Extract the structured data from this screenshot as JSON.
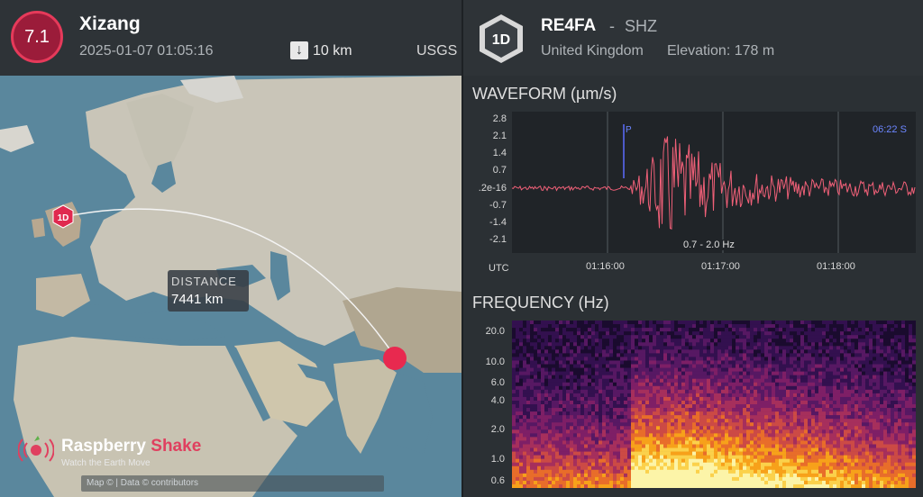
{
  "event": {
    "magnitude": "7.1",
    "region": "Xizang",
    "datetime": "2025-01-07 01:05:16",
    "depth": "10 km",
    "source": "USGS"
  },
  "map": {
    "station_marker": "1D",
    "distance_label": "DISTANCE",
    "distance_value": "7441 km",
    "brand_part1": "Raspberry",
    "brand_part2": "Shake",
    "tagline": "Watch the Earth Move",
    "attribution": "Map ©          | Data ©                    contributors"
  },
  "station": {
    "badge": "1D",
    "code": "RE4FA",
    "separator": "-",
    "channel": "SHZ",
    "country": "United Kingdom",
    "elevation": "Elevation: 178 m"
  },
  "waveform": {
    "title": "WAVEFORM (µm/s)",
    "y_ticks": [
      "2.8",
      "2.1",
      "1.4",
      "0.7",
      ".2e-16",
      "-0.7",
      "-1.4",
      "-2.1"
    ],
    "x_ticks": [
      "01:16:00",
      "01:17:00",
      "01:18:00"
    ],
    "utc_label": "UTC",
    "filter": "0.7 - 2.0 Hz",
    "time_readout": "06:22  S",
    "p_marker": "P",
    "trace_color": "#f06078"
  },
  "frequency": {
    "title": "FREQUENCY (Hz)",
    "y_ticks": [
      "20.0",
      "10.0",
      "6.0",
      "4.0",
      "2.0",
      "1.0",
      "0.6"
    ]
  },
  "colors": {
    "magnitude_fill": "#9b1c3a",
    "magnitude_ring": "#e63a5a",
    "epicenter": "#e8294f",
    "panel_bg": "#2e3337"
  }
}
